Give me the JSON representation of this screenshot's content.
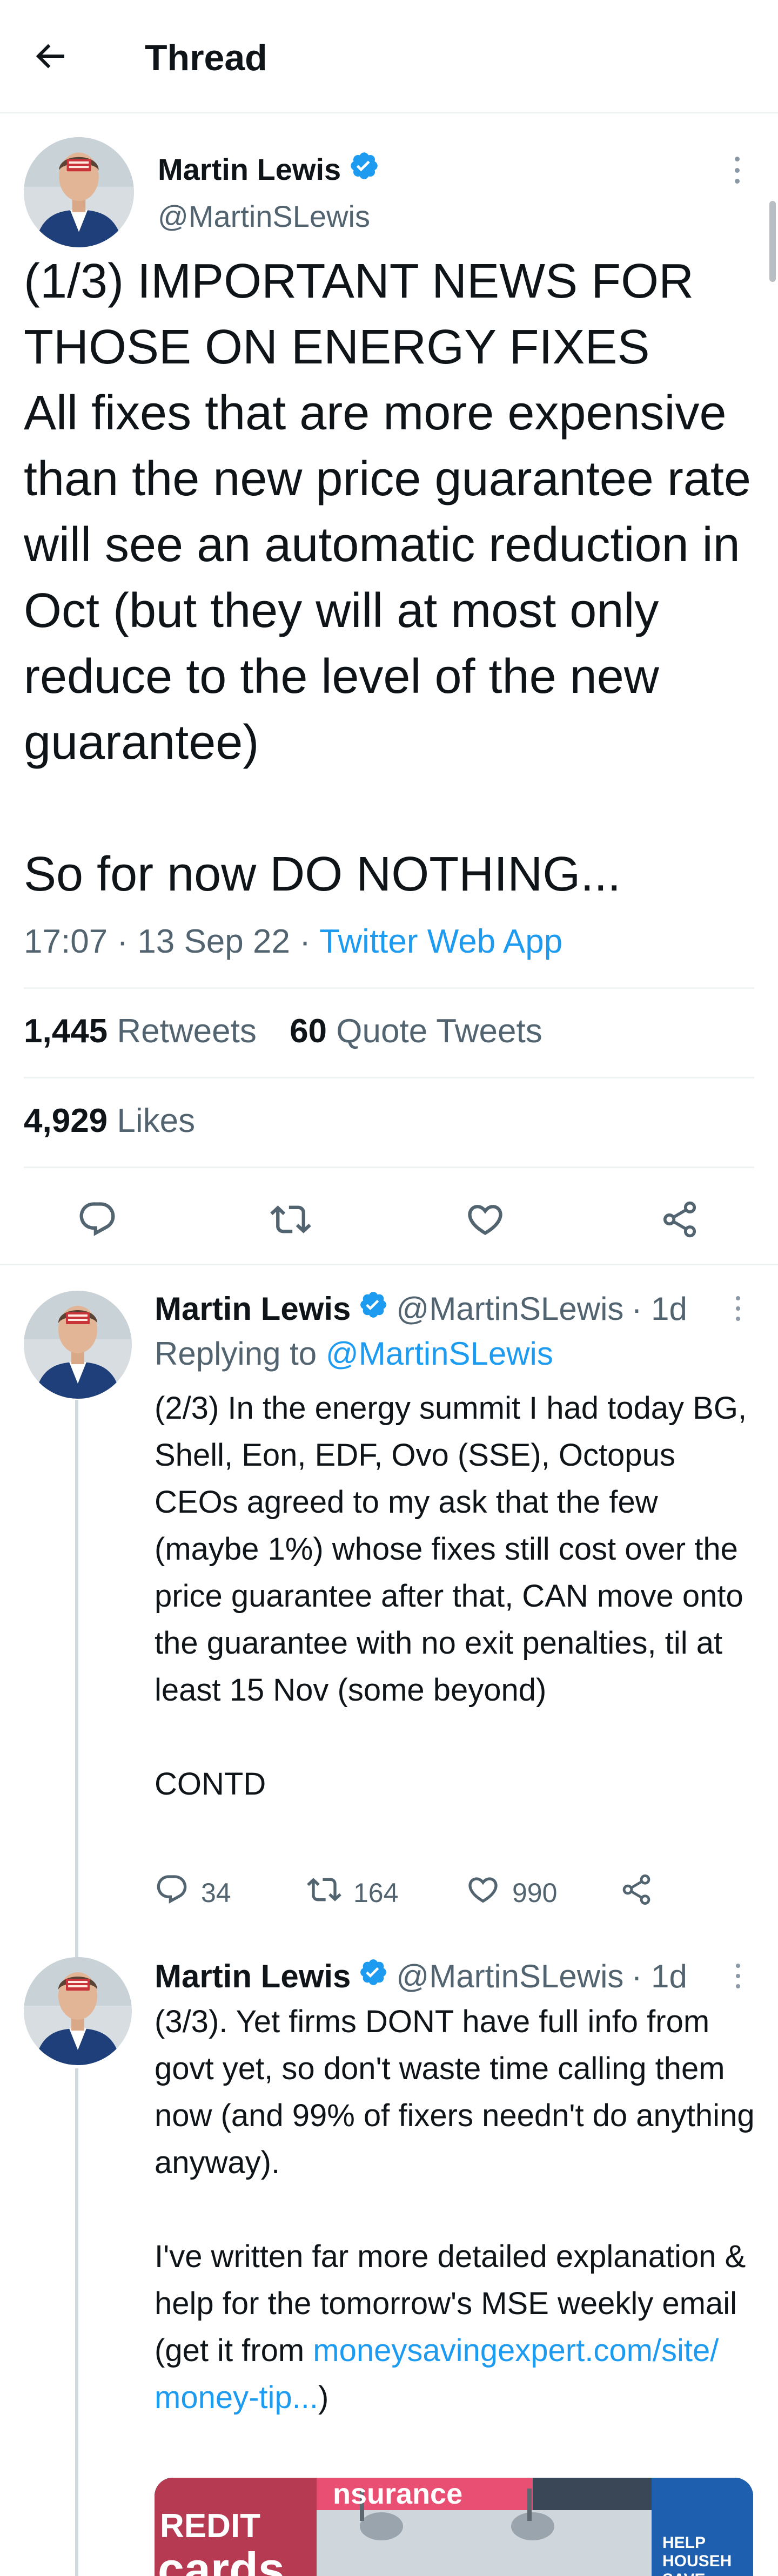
{
  "header": {
    "title": "Thread"
  },
  "main_tweet": {
    "name": "Martin Lewis",
    "handle": "@MartinSLewis",
    "text": "(1/3) IMPORTANT NEWS FOR THOSE ON ENERGY FIXES\nAll fixes that are more expensive than the new price guarantee rate will see an automatic reduction in Oct (but they will at most only reduce to the level of the new guarantee)\n\nSo for now DO NOTHING...",
    "time": "17:07",
    "date": "13 Sep 22",
    "separator": " · ",
    "source": "Twitter Web App",
    "retweets_count": "1,445",
    "retweets_label": "Retweets",
    "quotes_count": "60",
    "quotes_label": "Quote Tweets",
    "likes_count": "4,929",
    "likes_label": "Likes"
  },
  "replies": [
    {
      "name": "Martin Lewis",
      "handle": "@MartinSLewis",
      "age": "· 1d",
      "replying_prefix": "Replying to ",
      "replying_to": "@MartinSLewis",
      "text": "(2/3) In the energy summit I had today BG, Shell, Eon, EDF, Ovo (SSE), Octopus CEOs agreed to my ask that the few (maybe 1%) whose fixes still cost over the price guarantee after that, CAN move onto the guarantee with no exit penalties, til at least 15 Nov (some beyond)\n\nCONTD",
      "reply_count": "34",
      "retweet_count": "164",
      "like_count": "990"
    },
    {
      "name": "Martin Lewis",
      "handle": "@MartinSLewis",
      "age": "· 1d",
      "text": "(3/3). Yet firms DONT have full info from govt yet, so don't waste time calling them now (and 99% of fixers needn't do anything anyway).\n\nI've written far more detailed explanation & help for the tomorrow's MSE weekly email  (get it from ",
      "link": "moneysavingexpert.com/site/\nmoney-tip...",
      "text_end": ")",
      "media_text_1": "REDIT",
      "media_text_2": "cards",
      "media_text_3": "nsurance",
      "media_text_4": "HELP\nHOUSEH\nSAVE"
    }
  ],
  "colors": {
    "accent": "#1d9bf0",
    "text": "#0f1419",
    "secondary": "#536471",
    "divider": "#eff3f4",
    "thread_line": "#cfd9de"
  },
  "icons": {
    "back": "arrow-left-icon",
    "verified": "verified-badge-icon",
    "more": "more-vertical-icon",
    "reply": "reply-bubble-icon",
    "retweet": "retweet-icon",
    "like": "heart-icon",
    "share": "share-icon"
  }
}
